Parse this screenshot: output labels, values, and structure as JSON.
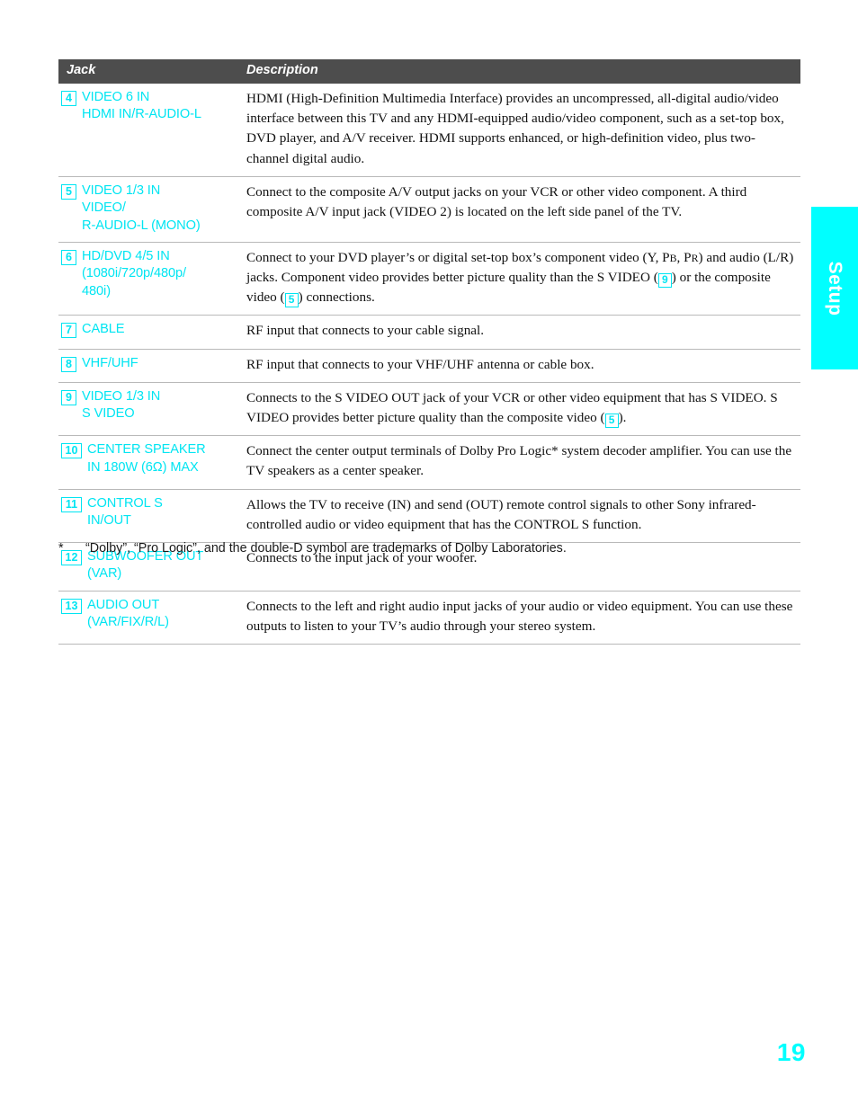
{
  "colors": {
    "accent_cyan": "#00e5f2",
    "tab_cyan": "#00ffff",
    "header_gray": "#4d4d4d",
    "rule_gray": "#b9b9b9"
  },
  "side_tab": {
    "label": "Setup"
  },
  "table": {
    "headers": {
      "jack": "Jack",
      "description": "Description"
    },
    "rows": [
      {
        "num": "4",
        "jack_lines": [
          "VIDEO 6 IN",
          "HDMI IN/R-AUDIO-L"
        ],
        "description": "HDMI (High-Definition Multimedia Interface) provides an uncompressed, all-digital audio/video interface between this TV and any HDMI-equipped audio/video component, such as a set-top box, DVD player, and A/V receiver. HDMI supports enhanced, or high-definition video, plus two-channel digital audio."
      },
      {
        "num": "5",
        "jack_lines": [
          "VIDEO 1/3 IN",
          "VIDEO/",
          "R-AUDIO-L (MONO)"
        ],
        "description": "Connect to the composite A/V output jacks on your VCR or other video component. A third composite A/V input jack (VIDEO 2) is located on the left side panel of the TV."
      },
      {
        "num": "6",
        "jack_lines": [
          "HD/DVD 4/5 IN",
          "(1080i/720p/480p/",
          "480i)"
        ],
        "description_parts": [
          {
            "type": "text",
            "value": "Connect to your DVD player’s or digital set-top box’s component video (Y, P"
          },
          {
            "type": "smallcap",
            "value": "B"
          },
          {
            "type": "text",
            "value": ", P"
          },
          {
            "type": "smallcap",
            "value": "R"
          },
          {
            "type": "text",
            "value": ") and audio (L/R) jacks. Component video provides better picture quality than the S VIDEO ("
          },
          {
            "type": "ref",
            "value": "9"
          },
          {
            "type": "text",
            "value": ") or the composite video ("
          },
          {
            "type": "ref",
            "value": "5"
          },
          {
            "type": "text",
            "value": ") connections."
          }
        ]
      },
      {
        "num": "7",
        "jack_lines": [
          "CABLE"
        ],
        "description": "RF input that connects to your cable signal."
      },
      {
        "num": "8",
        "jack_lines": [
          "VHF/UHF"
        ],
        "description": "RF input that connects to your VHF/UHF antenna or cable box."
      },
      {
        "num": "9",
        "jack_lines": [
          "VIDEO 1/3 IN",
          "S VIDEO"
        ],
        "description_parts": [
          {
            "type": "text",
            "value": "Connects to the S VIDEO OUT jack of your VCR or other video equipment that has S VIDEO. S VIDEO provides better picture quality than the composite video ("
          },
          {
            "type": "ref",
            "value": "5"
          },
          {
            "type": "text",
            "value": ")."
          }
        ]
      },
      {
        "num": "10",
        "jack_lines": [
          "CENTER SPEAKER",
          "IN 180W (6Ω) MAX"
        ],
        "description": "Connect the center output terminals of Dolby Pro Logic* system decoder amplifier. You can use the TV speakers as a center speaker."
      },
      {
        "num": "11",
        "jack_lines": [
          "CONTROL S",
          "IN/OUT"
        ],
        "description": "Allows the TV to receive (IN) and send (OUT) remote control signals to other Sony infrared-controlled audio or video equipment that has the CONTROL S function."
      },
      {
        "num": "12",
        "jack_lines": [
          "SUBWOOFER OUT",
          "(VAR)"
        ],
        "description": "Connects to the input jack of your woofer."
      },
      {
        "num": "13",
        "jack_lines": [
          "AUDIO OUT",
          "(VAR/FIX/R/L)"
        ],
        "description": "Connects to the left and right audio input jacks of your audio or video equipment. You can use these outputs to listen to your TV’s audio through your stereo system."
      }
    ]
  },
  "footnote": {
    "marker": "*",
    "text": "“Dolby”, “Pro Logic”, and the double-D symbol are trademarks of Dolby Laboratories."
  },
  "page_number": "19"
}
